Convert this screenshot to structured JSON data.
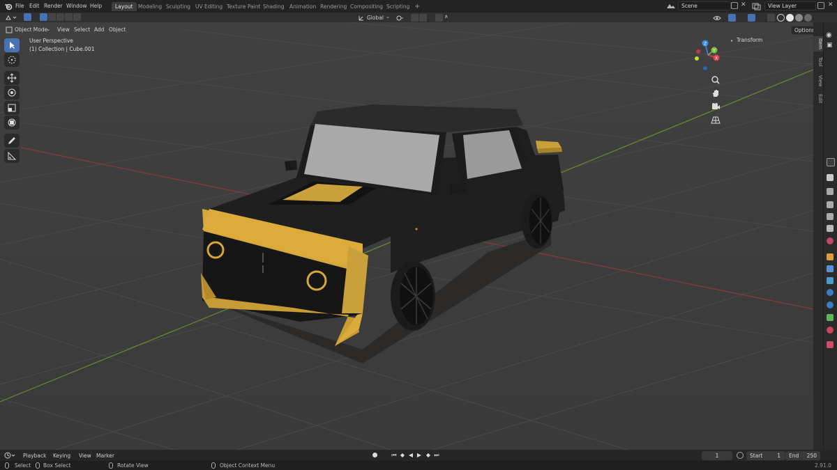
{
  "topbar": {
    "menus": [
      "File",
      "Edit",
      "Render",
      "Window",
      "Help"
    ],
    "workspaces": [
      "Layout",
      "Modeling",
      "Sculpting",
      "UV Editing",
      "Texture Paint",
      "Shading",
      "Animation",
      "Rendering",
      "Compositing",
      "Scripting"
    ],
    "active_workspace": "Layout",
    "add_tab": "+",
    "scene": "Scene",
    "view_layer": "View Layer"
  },
  "header": {
    "mode": "Object Mode",
    "menus": [
      "View",
      "Select",
      "Add",
      "Object"
    ],
    "orientation": "Global",
    "options": "Options"
  },
  "viewport": {
    "perspective": "User Perspective",
    "collection": "(1) Collection | Cube.001",
    "gizmo_axes": {
      "x": "X",
      "y": "Y",
      "z": "Z"
    },
    "colors": {
      "x": "#e0434f",
      "y": "#7bbf3a",
      "z": "#3b8ee6",
      "selection": "#4772b3",
      "car_accent": "#d4a53a",
      "car_body": "#232323"
    }
  },
  "n_panel": {
    "transform": "Transform",
    "tabs": [
      "Item",
      "Tool",
      "View",
      "Edit"
    ]
  },
  "toolbar": {
    "tools": [
      "select-box-tool",
      "cursor-tool",
      "move-tool",
      "rotate-tool",
      "scale-tool",
      "transform-tool",
      "annotate-tool",
      "measure-tool"
    ]
  },
  "timeline": {
    "menus": [
      "Playback",
      "Keying",
      "View",
      "Marker"
    ],
    "current_frame": "1",
    "start_label": "Start",
    "start": "1",
    "end_label": "End",
    "end": "250"
  },
  "statusbar": {
    "select": "Select",
    "box_select": "Box Select",
    "rotate_view": "Rotate View",
    "context_menu": "Object Context Menu",
    "version": "2.91.0"
  }
}
